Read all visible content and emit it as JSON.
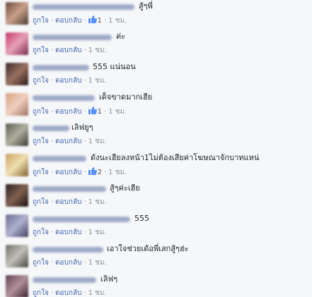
{
  "actions": {
    "like": "ถูกใจ",
    "reply": "ตอบกลับ",
    "separator": "·"
  },
  "comments": [
    {
      "text": "สู้ๆพี่",
      "likes": "1",
      "time": "1 ชม."
    },
    {
      "text": "ค่ะ",
      "likes": null,
      "time": "1 ชม."
    },
    {
      "text": "555 แน่นอน",
      "likes": null,
      "time": "1 ชม."
    },
    {
      "text": "เด็จขาดมากเฮีย",
      "likes": "1",
      "time": "1 ชม."
    },
    {
      "text": "เลิฟยูๆ",
      "likes": null,
      "time": "1 ชม."
    },
    {
      "text": "ดังนะเฮียลงหน้า1ไม่ต้องเสียค่าโฆษณาจักบาทแหน่",
      "likes": "2",
      "time": "1 ชม."
    },
    {
      "text": "สู้ๆค่ะเฮีย",
      "likes": null,
      "time": "1 ชม."
    },
    {
      "text": "555",
      "likes": null,
      "time": "1 ชม."
    },
    {
      "text": "เอาใจช่วยเด้อพี่เสกสู้ๆฮ่ะ",
      "likes": null,
      "time": "1 ชม."
    },
    {
      "text": "เลิฟๆ",
      "likes": null,
      "time": "1 ชม."
    }
  ],
  "colors": {
    "link": "#4267b2",
    "meta_text": "#90949c",
    "like_icon": "#5890ff",
    "background": "#f6f7f9"
  },
  "icons": {
    "like": "thumbs-up-icon"
  }
}
